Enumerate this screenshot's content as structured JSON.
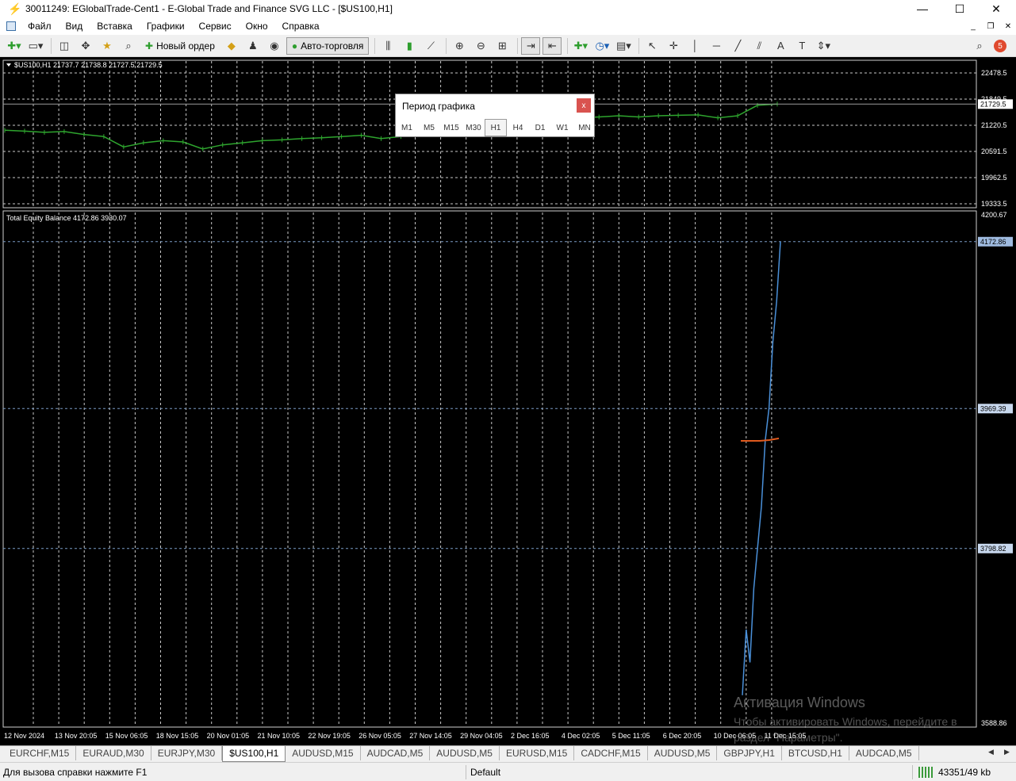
{
  "window": {
    "title": "30011249: EGlobalTrade-Cent1 - E-Global Trade and Finance SVG LLC - [$US100,H1]",
    "min_glyph": "—",
    "max_glyph": "☐",
    "close_glyph": "✕"
  },
  "menu": {
    "items": [
      "Файл",
      "Вид",
      "Вставка",
      "Графики",
      "Сервис",
      "Окно",
      "Справка"
    ],
    "mdi_min": "_",
    "mdi_restore": "❐",
    "mdi_close": "✕"
  },
  "toolbar": {
    "new_order_label": "Новый ордер",
    "autotrading_label": "Авто-торговля",
    "notification_count": "5"
  },
  "main_chart": {
    "header": "$US100,H1  21737.7 21738.8 21727.5 21729.5",
    "current_price_label": "21729.5",
    "price_ticks": [
      "22478.5",
      "21849.5",
      "21220.5",
      "20591.5",
      "19962.5",
      "19333.5"
    ],
    "price_tick_values": [
      22478.5,
      21849.5,
      21220.5,
      20591.5,
      19962.5,
      19333.5
    ],
    "current_price": 21729.5,
    "ylim": [
      19333.5,
      22478.5
    ],
    "series_color": "#2ea52e"
  },
  "equity_chart": {
    "header": "Total Equity Balance 4172.86 3930.07",
    "top_label": "4200.67",
    "current_label": "4172.86",
    "level_labels": [
      "3969.39",
      "3798.82"
    ],
    "level_values": [
      3969.39,
      3798.82
    ],
    "bottom_label": "3588.86",
    "ylim": [
      3588.86,
      4200.67
    ],
    "equity_color": "#4a90d9",
    "balance_color": "#e05a1e"
  },
  "chart_data": [
    {
      "type": "line",
      "title": "$US100,H1",
      "ylim": [
        19333.5,
        22478.5
      ],
      "series": [
        {
          "values": [
            21100,
            21080,
            21050,
            21070,
            21000,
            20950,
            20700,
            20800,
            20850,
            20820,
            20650,
            20750,
            20800,
            20850,
            20870,
            20900,
            20920,
            20950,
            20980,
            20900,
            20950,
            21000,
            21050,
            21100,
            21150,
            21200,
            21250,
            21300,
            21350,
            21400,
            21420,
            21450,
            21420,
            21450,
            21460,
            21470,
            21400,
            21450,
            21700,
            21730
          ]
        }
      ]
    },
    {
      "type": "line",
      "title": "Total Equity Balance",
      "ylim": [
        3588.86,
        4200.67
      ],
      "series": [
        {
          "name": "Equity",
          "values": [
            3620,
            3700,
            3660,
            3750,
            3800,
            3850,
            3930,
            3970,
            4050,
            4100,
            4172.86
          ]
        },
        {
          "name": "Balance",
          "values": [
            3930.07,
            3930.07,
            3930.07,
            3931,
            3933
          ]
        }
      ]
    }
  ],
  "time_axis": {
    "labels": [
      "12 Nov 2024",
      "13 Nov 20:05",
      "15 Nov 06:05",
      "18 Nov 15:05",
      "20 Nov 01:05",
      "21 Nov 10:05",
      "22 Nov 19:05",
      "26 Nov 05:05",
      "27 Nov 14:05",
      "29 Nov 04:05",
      "2 Dec 16:05",
      "4 Dec 02:05",
      "5 Dec 11:05",
      "6 Dec 20:05",
      "10 Dec 06:05",
      "11 Dec 15:05"
    ]
  },
  "period_dialog": {
    "title": "Период графика",
    "close_glyph": "x",
    "periods": [
      "M1",
      "M5",
      "M15",
      "M30",
      "H1",
      "H4",
      "D1",
      "W1",
      "MN"
    ],
    "active": "H1"
  },
  "watermark": {
    "line1": "Активация Windows",
    "line2": "Чтобы активировать Windows, перейдите в раздел \"Параметры\"."
  },
  "tabs": {
    "items": [
      "EURCHF,M15",
      "EURAUD,M30",
      "EURJPY,M30",
      "$US100,H1",
      "AUDUSD,M15",
      "AUDCAD,M5",
      "AUDUSD,M5",
      "EURUSD,M15",
      "CADCHF,M15",
      "AUDUSD,M5",
      "GBPJPY,H1",
      "BTCUSD,H1",
      "AUDCAD,M5"
    ],
    "active_index": 3,
    "prev_glyph": "◀",
    "next_glyph": "▶"
  },
  "status": {
    "help_text": "Для вызова справки нажмите F1",
    "profile": "Default",
    "traffic": "43351/49 kb"
  }
}
